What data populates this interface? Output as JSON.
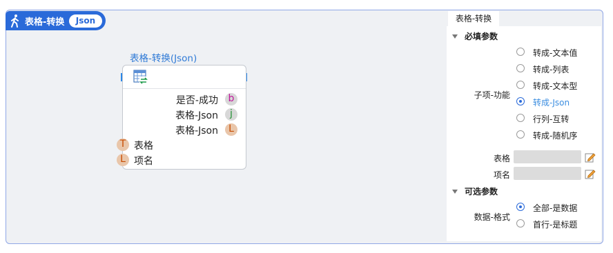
{
  "header": {
    "title": "表格-转换",
    "tag": "Json"
  },
  "node": {
    "title": "表格-转换(Json)",
    "outputs": [
      {
        "label": "是否-成功",
        "badge": "b"
      },
      {
        "label": "表格-Json",
        "badge": "j"
      },
      {
        "label": "表格-Json",
        "badge": "L"
      }
    ],
    "inputs": [
      {
        "label": "表格",
        "badge": "T"
      },
      {
        "label": "项名",
        "badge": "L"
      }
    ]
  },
  "panel": {
    "tab": "表格-转换",
    "required_section": "必填参数",
    "sub_function_label": "子项-功能",
    "options": [
      "转成-文本值",
      "转成-列表",
      "转成-文本型",
      "转成-Json",
      "行列-互转",
      "转成-随机序"
    ],
    "selected_option": "转成-Json",
    "table_label": "表格",
    "item_label": "项名",
    "optional_section": "可选参数",
    "data_format_label": "数据-格式",
    "format_options": [
      "全部-是数据",
      "首行-是标题"
    ],
    "selected_format": "全部-是数据"
  },
  "colors": {
    "accent": "#2a6ad9",
    "link": "#3b8de0",
    "canvas": "#eff1f4"
  }
}
